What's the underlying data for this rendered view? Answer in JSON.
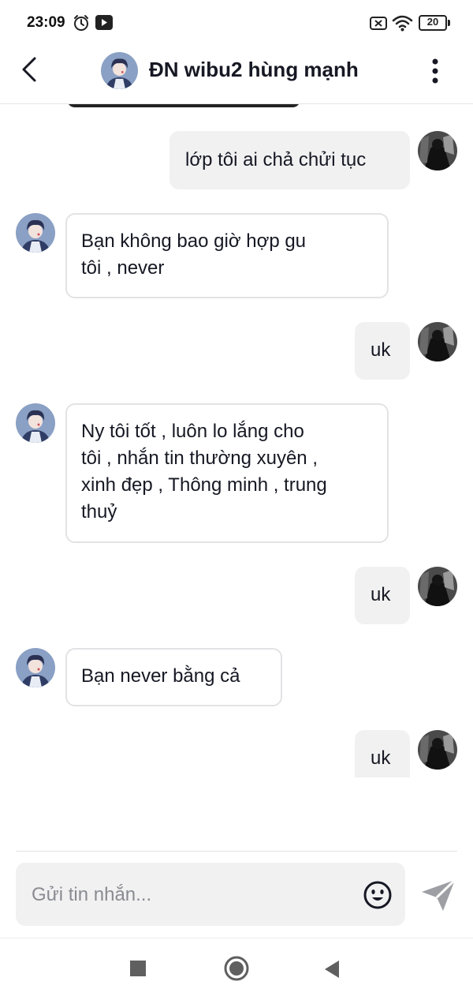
{
  "status_bar": {
    "time": "23:09",
    "battery": "20",
    "icons": [
      "alarm-icon",
      "youtube-icon",
      "no-sim-icon",
      "wifi-icon",
      "battery-icon"
    ]
  },
  "header": {
    "title": "ĐN wibu2 hùng mạnh",
    "back_icon": "chevron-left-icon",
    "more_icon": "vertical-dots-icon"
  },
  "messages": [
    {
      "direction": "out",
      "lines": [
        "lớp tôi ai chả chửi tục"
      ]
    },
    {
      "direction": "in",
      "lines": [
        "Bạn không bao giờ hợp gu",
        "tôi , never"
      ]
    },
    {
      "direction": "out",
      "lines": [
        "uk"
      ]
    },
    {
      "direction": "in",
      "lines": [
        "Ny tôi tốt , luôn lo lắng cho",
        "tôi , nhắn tin thường xuyên ,",
        "xinh đẹp , Thông minh , trung",
        "thuỷ"
      ]
    },
    {
      "direction": "out",
      "lines": [
        "uk"
      ]
    },
    {
      "direction": "in",
      "lines": [
        "Bạn never bằng cả"
      ]
    },
    {
      "direction": "out",
      "lines": [
        "uk"
      ]
    }
  ],
  "composer": {
    "placeholder": "Gửi tin nhắn...",
    "emoji_icon": "smiley-icon",
    "send_icon": "send-icon"
  },
  "nav_bar": {
    "icons": [
      "square-recents-icon",
      "circle-home-icon",
      "triangle-back-icon"
    ]
  },
  "colors": {
    "outgoing_bubble": "#f1f1f2",
    "incoming_border": "#e3e3e6",
    "text": "#161823",
    "placeholder": "#8a8b91"
  }
}
